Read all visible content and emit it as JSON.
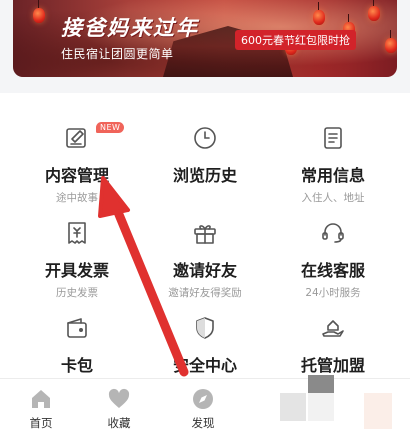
{
  "banner": {
    "title": "接爸妈来过年",
    "subtitle": "住民宿让团圆更简单",
    "promo": "600元春节红包限时抢"
  },
  "menu": {
    "badge_new": "NEW",
    "items": [
      {
        "title": "内容管理",
        "subtitle": "途中故事",
        "icon": "edit-document-icon"
      },
      {
        "title": "浏览历史",
        "subtitle": "",
        "icon": "clock-icon"
      },
      {
        "title": "常用信息",
        "subtitle": "入住人、地址",
        "icon": "info-list-icon"
      },
      {
        "title": "开具发票",
        "subtitle": "历史发票",
        "icon": "invoice-icon"
      },
      {
        "title": "邀请好友",
        "subtitle": "邀请好友得奖励",
        "icon": "gift-icon"
      },
      {
        "title": "在线客服",
        "subtitle": "24小时服务",
        "icon": "headset-icon"
      },
      {
        "title": "卡包",
        "subtitle": "",
        "icon": "wallet-icon"
      },
      {
        "title": "安全中心",
        "subtitle": "",
        "icon": "shield-icon"
      },
      {
        "title": "托管加盟",
        "subtitle": "",
        "icon": "house-hand-icon"
      }
    ]
  },
  "tabbar": {
    "items": [
      {
        "label": "首页",
        "icon": "home-icon"
      },
      {
        "label": "收藏",
        "icon": "heart-icon"
      },
      {
        "label": "发现",
        "icon": "compass-icon"
      },
      {
        "label": "",
        "icon": "message-icon"
      },
      {
        "label": "",
        "icon": "profile-icon"
      }
    ]
  },
  "colors": {
    "accent_red": "#e0312f",
    "badge_red": "#f0645a",
    "icon_gray": "#555555",
    "tab_icon_gray": "#b5b5b5",
    "subtitle_gray": "#9a9a9a"
  }
}
